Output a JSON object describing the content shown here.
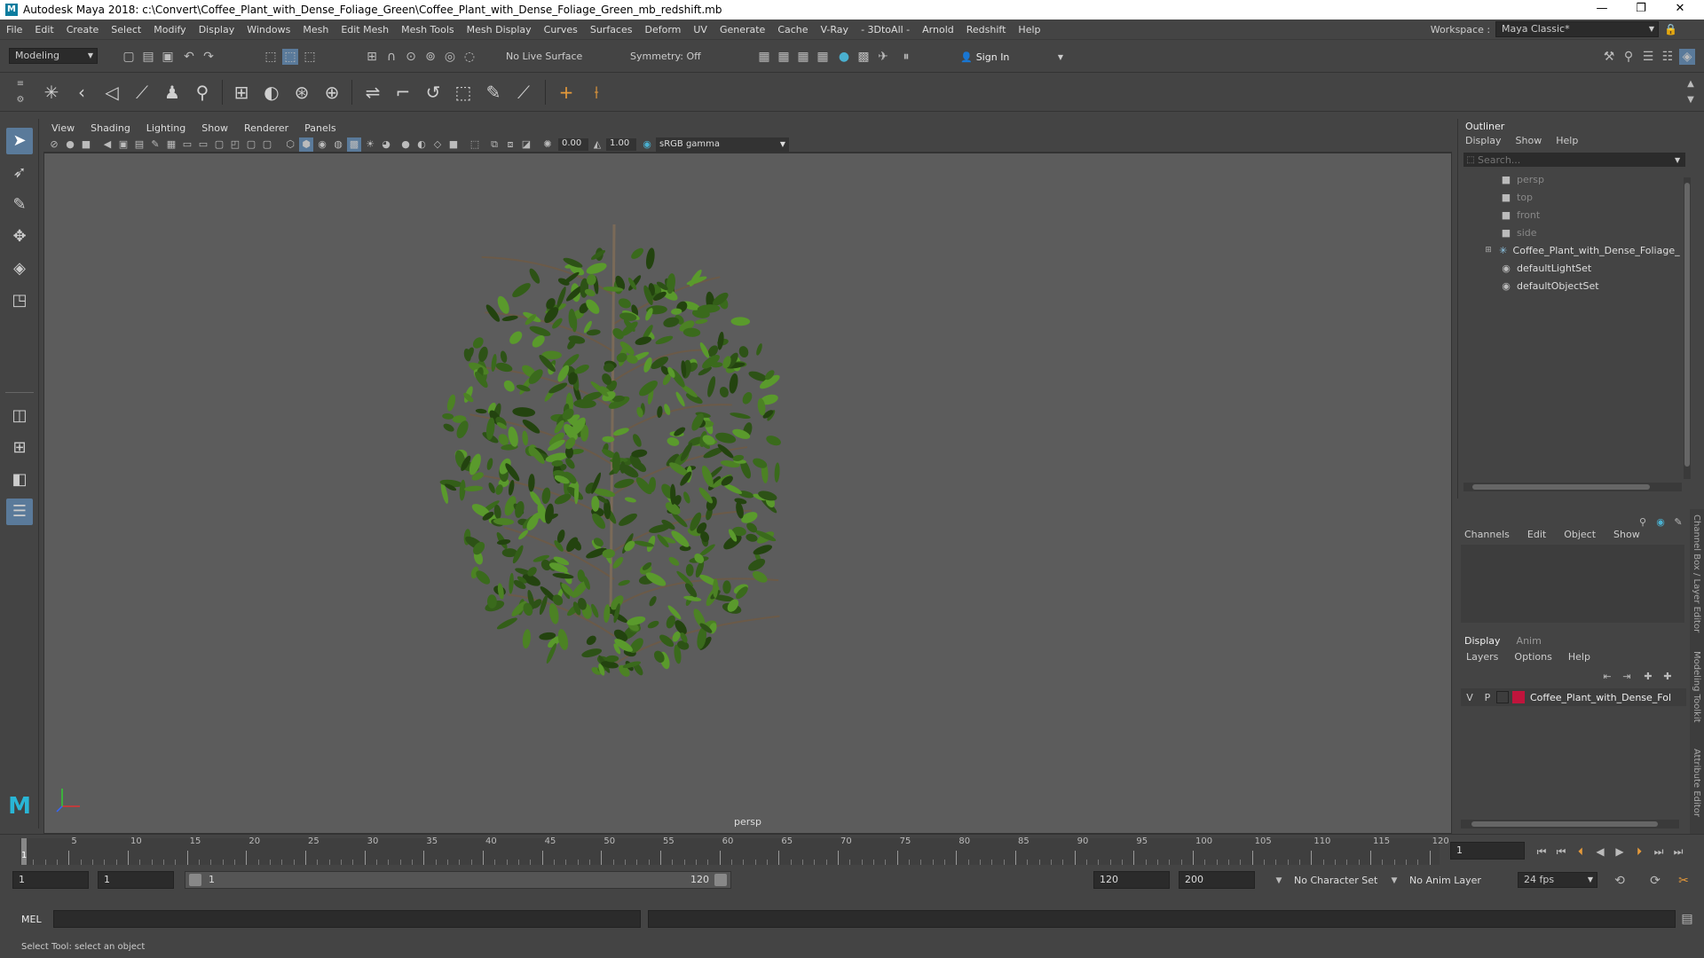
{
  "window": {
    "title": "Autodesk Maya 2018: c:\\Convert\\Coffee_Plant_with_Dense_Foliage_Green\\Coffee_Plant_with_Dense_Foliage_Green_mb_redshift.mb",
    "minimize": "—",
    "restore": "❐",
    "close": "✕"
  },
  "menu": [
    "File",
    "Edit",
    "Create",
    "Select",
    "Modify",
    "Display",
    "Windows",
    "Mesh",
    "Edit Mesh",
    "Mesh Tools",
    "Mesh Display",
    "Curves",
    "Surfaces",
    "Deform",
    "UV",
    "Generate",
    "Cache",
    "V-Ray",
    "- 3DtoAll -",
    "Arnold",
    "Redshift",
    "Help"
  ],
  "workspace": {
    "label": "Workspace :",
    "value": "Maya Classic*"
  },
  "status": {
    "mode": "Modeling",
    "live_surface": "No Live Surface",
    "symmetry": "Symmetry: Off",
    "sign_in": "Sign In"
  },
  "viewport": {
    "menu": [
      "View",
      "Shading",
      "Lighting",
      "Show",
      "Renderer",
      "Panels"
    ],
    "exposure": "0.00",
    "gamma": "1.00",
    "color_space": "sRGB gamma",
    "camera": "persp"
  },
  "outliner": {
    "title": "Outliner",
    "menu": [
      "Display",
      "Show",
      "Help"
    ],
    "search_placeholder": "Search...",
    "items": [
      {
        "label": "persp",
        "icon": "camera-icon",
        "dim": true
      },
      {
        "label": "top",
        "icon": "camera-icon",
        "dim": true
      },
      {
        "label": "front",
        "icon": "camera-icon",
        "dim": true
      },
      {
        "label": "side",
        "icon": "camera-icon",
        "dim": true
      },
      {
        "label": "Coffee_Plant_with_Dense_Foliage_Green",
        "icon": "group-icon",
        "dim": false
      },
      {
        "label": "defaultLightSet",
        "icon": "set-icon",
        "dim": false
      },
      {
        "label": "defaultObjectSet",
        "icon": "set-icon",
        "dim": false
      }
    ]
  },
  "channel_box": {
    "menu": [
      "Channels",
      "Edit",
      "Object",
      "Show"
    ]
  },
  "layer_editor": {
    "tabs": [
      "Display",
      "Anim"
    ],
    "menu": [
      "Layers",
      "Options",
      "Help"
    ],
    "layer": {
      "v": "V",
      "p": "P",
      "name": "Coffee_Plant_with_Dense_Foliage_Green",
      "color": "#c0143c"
    }
  },
  "side_tabs": [
    "Channel Box / Layer Editor",
    "Modeling Toolkit",
    "Attribute Editor"
  ],
  "timeline": {
    "ticks": [
      5,
      10,
      15,
      20,
      25,
      30,
      35,
      40,
      45,
      50,
      55,
      60,
      65,
      70,
      75,
      80,
      85,
      90,
      95,
      100,
      105,
      110,
      115,
      120
    ],
    "current_frame": "1",
    "first": "1"
  },
  "range": {
    "start": "1",
    "playback_start": "1",
    "slider_start": "1",
    "slider_end": "120",
    "playback_end": "120",
    "end": "200",
    "character_set": "No Character Set",
    "anim_layer": "No Anim Layer",
    "fps": "24 fps"
  },
  "command": {
    "lang": "MEL"
  },
  "help_line": "Select Tool: select an object"
}
